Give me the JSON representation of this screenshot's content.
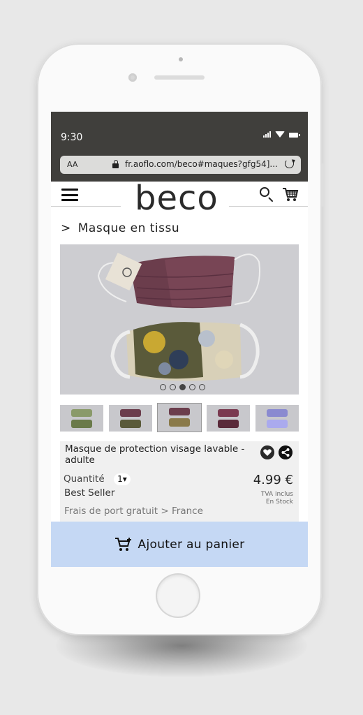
{
  "status": {
    "time": "9:30"
  },
  "browser": {
    "text_size": "AA",
    "url": "fr.aoflo.com/beco#maques?gfg54]..."
  },
  "header": {
    "logo": "beco",
    "menu_icon": "hamburger-icon",
    "search_icon": "search-icon",
    "cart_icon": "cart-icon"
  },
  "breadcrumb": {
    "chevron": ">",
    "title": "Masque en tissu"
  },
  "carousel": {
    "slides": 5,
    "active_index": 2
  },
  "thumbnails": {
    "count": 5,
    "active_index": 2
  },
  "product": {
    "name": "Masque de protection visage lavable - adulte",
    "quantity_label": "Quantité",
    "quantity_value": "1▾",
    "price": "4.99 €",
    "badge": "Best Seller",
    "tax_note": "TVA inclus",
    "stock": "En Stock",
    "shipping": "Frais de port gratuit  >  France"
  },
  "cta": {
    "label": "Ajouter au panier"
  },
  "colors": {
    "statusbar": "#403f3c",
    "cta_bg": "#c5d8f4",
    "info_bg": "#f0f0f0"
  }
}
